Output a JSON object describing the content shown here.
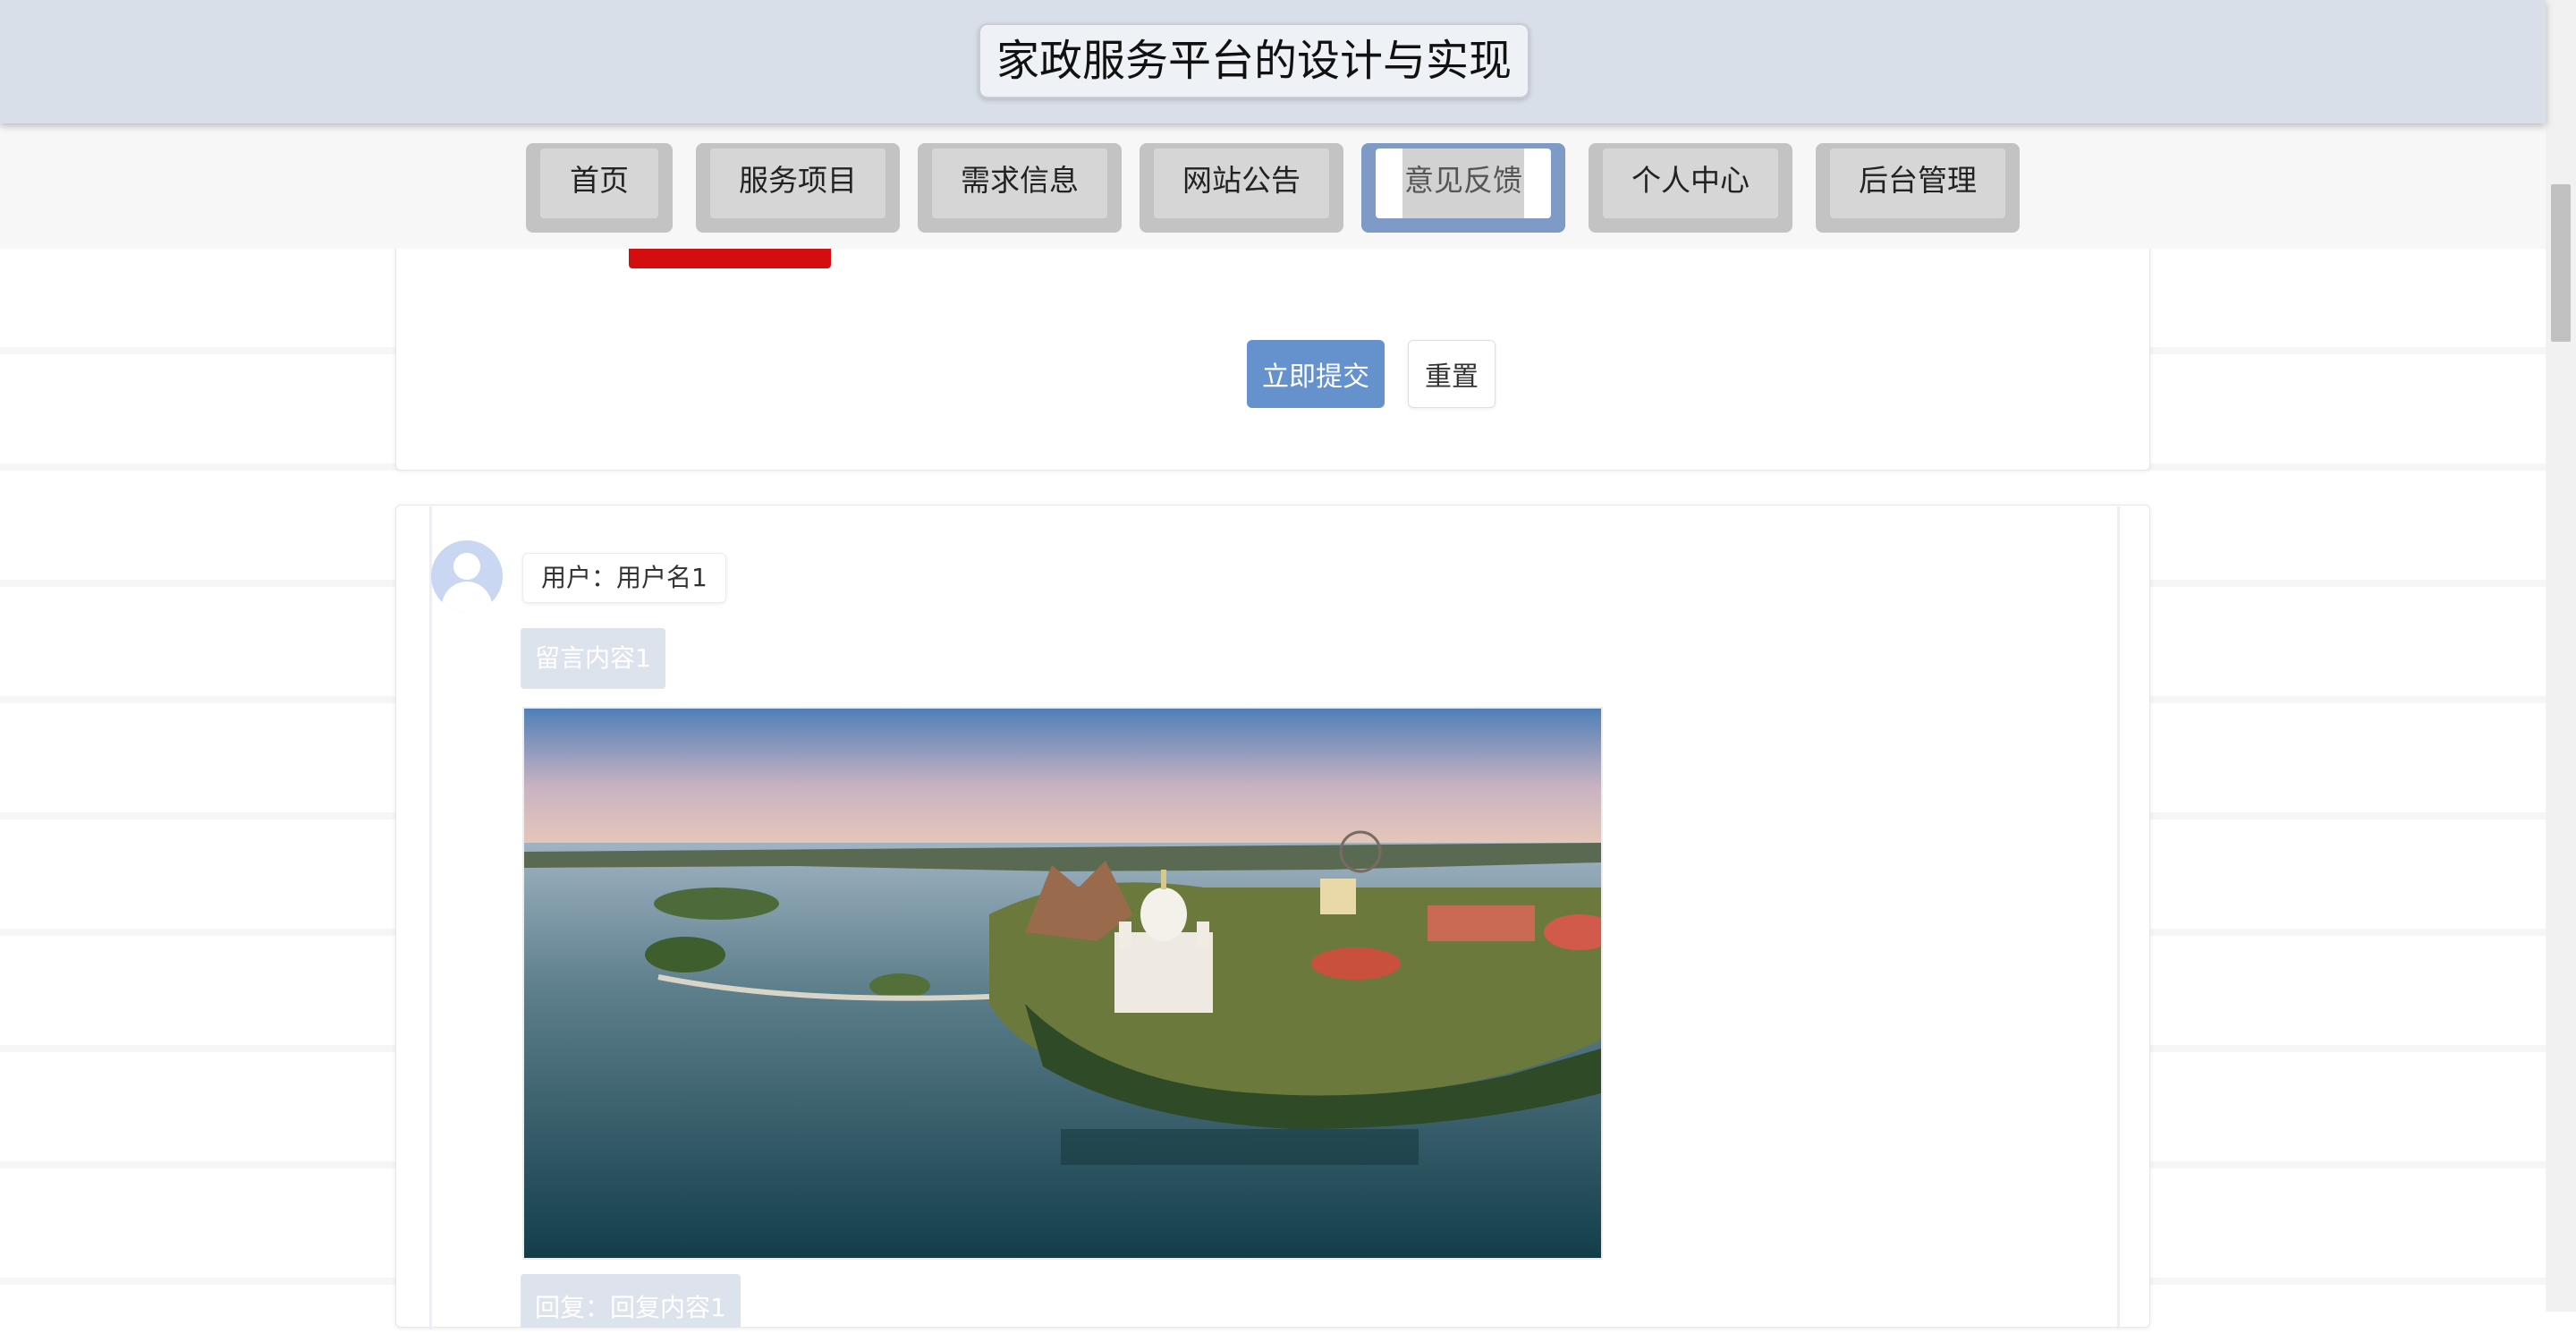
{
  "header": {
    "title": "家政服务平台的设计与实现"
  },
  "nav": {
    "items": [
      {
        "label": "首页"
      },
      {
        "label": "服务项目"
      },
      {
        "label": "需求信息"
      },
      {
        "label": "网站公告"
      },
      {
        "label": "意见反馈",
        "active": true
      },
      {
        "label": "个人中心"
      },
      {
        "label": "后台管理"
      }
    ]
  },
  "form": {
    "submit_label": "立即提交",
    "reset_label": "重置"
  },
  "messages": [
    {
      "user": "用户：用户名1",
      "content": "留言内容1",
      "image": "lake-castle-aerial-photo",
      "reply": "回复：回复内容1"
    }
  ],
  "colors": {
    "header_bg": "#d9dfe8",
    "nav_active": "#7d9bc6",
    "primary_button": "#6592cc",
    "accent_red": "#d40e0e"
  }
}
